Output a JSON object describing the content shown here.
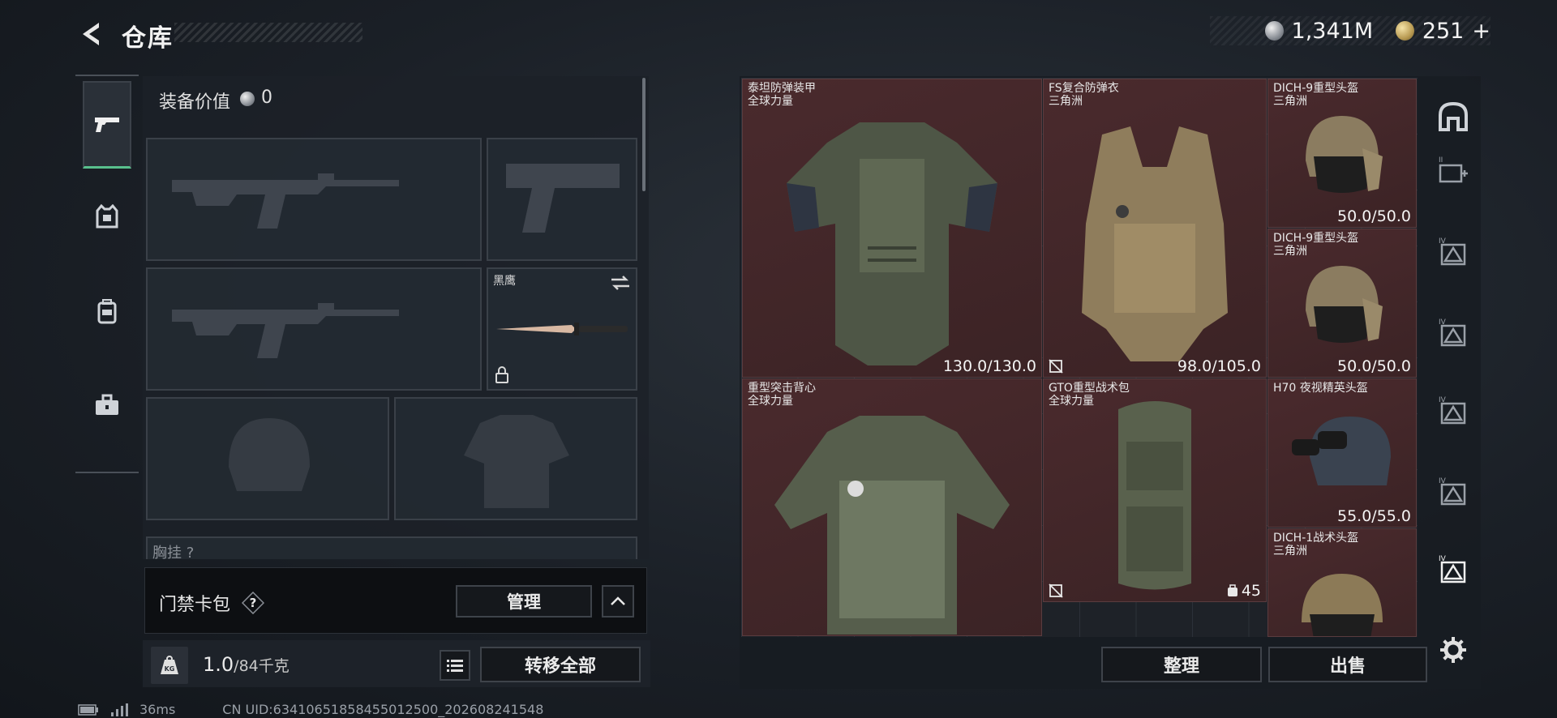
{
  "header": {
    "title": "仓库",
    "currency": {
      "silver": "1,341M",
      "gold": "251",
      "gold_add": "+"
    }
  },
  "sidebar_tabs": [
    {
      "name": "weapons",
      "icon": "pistol-icon",
      "active": true
    },
    {
      "name": "gear",
      "icon": "vest-icon",
      "active": false
    },
    {
      "name": "backpack",
      "icon": "backpack-icon",
      "active": false
    },
    {
      "name": "case",
      "icon": "briefcase-icon",
      "active": false
    }
  ],
  "equipment": {
    "value_label": "装备价值",
    "value": "0",
    "knife_slot": {
      "name": "黑鹰"
    },
    "chest_partial_label": "胸挂 ?"
  },
  "cardbag": {
    "label": "门禁卡包",
    "help": "?",
    "manage_button": "管理"
  },
  "bottom": {
    "weight": "1.0",
    "weight_max": "/84千克",
    "transfer_all": "转移全部"
  },
  "status": {
    "ping": "36ms",
    "uid": "CN UID:634106518584550125​00_202608241548"
  },
  "storage": {
    "items": [
      {
        "name": "泰坦防弹装甲",
        "sub": "全球力量",
        "dur": "130.0/130.0",
        "flag": false
      },
      {
        "name": "FS复合防弹衣",
        "sub": "三角洲",
        "dur": "98.0/105.0",
        "flag": true
      },
      {
        "name": "DICH-9重型头盔",
        "sub": "三角洲",
        "dur": "50.0/50.0"
      },
      {
        "name": "DICH-9重型头盔",
        "sub": "三角洲",
        "dur": "50.0/50.0"
      },
      {
        "name": "重型突击背心",
        "sub": "全球力量",
        "dur": ""
      },
      {
        "name": "GTO重型战术包",
        "sub": "全球力量",
        "cap": "45",
        "flag": true
      },
      {
        "name": "H70 夜视精英头盔",
        "sub": "",
        "dur": "55.0/55.0"
      },
      {
        "name": "DICH-1战术头盔",
        "sub": "三角洲",
        "dur": ""
      }
    ],
    "sort_button": "整理",
    "sell_button": "出售"
  },
  "filters": [
    "II",
    "IV",
    "IV",
    "IV",
    "IV",
    "IV"
  ],
  "colors": {
    "accent_green": "#59c08d",
    "item_bg": "#4a2a2d"
  }
}
